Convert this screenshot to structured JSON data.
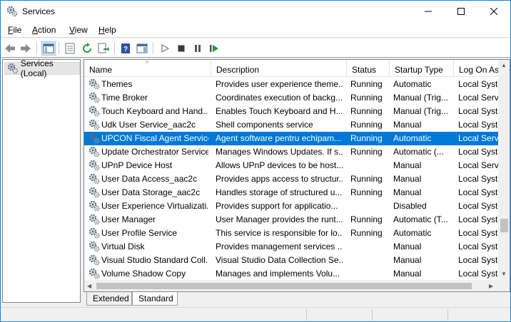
{
  "window": {
    "title": "Services"
  },
  "menu": {
    "file": {
      "accel": "F",
      "rest": "ile"
    },
    "action": {
      "accel": "A",
      "rest": "ction"
    },
    "view": {
      "accel": "V",
      "rest": "iew"
    },
    "help": {
      "accel": "H",
      "rest": "elp"
    }
  },
  "tree": {
    "label": "Services (Local)"
  },
  "columns": {
    "name": "Name",
    "description": "Description",
    "status": "Status",
    "startup": "Startup Type",
    "logon": "Log On As"
  },
  "rows": [
    {
      "name": "Themes",
      "description": "Provides user experience theme...",
      "status": "Running",
      "startup": "Automatic",
      "logon": "Local Syste"
    },
    {
      "name": "Time Broker",
      "description": "Coordinates execution of backg...",
      "status": "Running",
      "startup": "Manual (Trig...",
      "logon": "Local Servi"
    },
    {
      "name": "Touch Keyboard and Hand...",
      "description": "Enables Touch Keyboard and H...",
      "status": "Running",
      "startup": "Manual (Trig...",
      "logon": "Local Syste"
    },
    {
      "name": "Udk User Service_aac2c",
      "description": "Shell components service",
      "status": "Running",
      "startup": "Manual",
      "logon": "Local Syste"
    },
    {
      "name": "UPCON Fiscal Agent Service",
      "description": "Agent software pentru echipam...",
      "status": "Running",
      "startup": "Automatic",
      "logon": "Local Servi",
      "selected": true
    },
    {
      "name": "Update Orchestrator Service",
      "description": "Manages Windows Updates. If s...",
      "status": "Running",
      "startup": "Automatic (...",
      "logon": "Local Syste"
    },
    {
      "name": "UPnP Device Host",
      "description": "Allows UPnP devices to be host...",
      "status": "",
      "startup": "Manual",
      "logon": "Local Servi"
    },
    {
      "name": "User Data Access_aac2c",
      "description": "Provides apps access to structur...",
      "status": "Running",
      "startup": "Manual",
      "logon": "Local Syste"
    },
    {
      "name": "User Data Storage_aac2c",
      "description": "Handles storage of structured u...",
      "status": "Running",
      "startup": "Manual",
      "logon": "Local Syste"
    },
    {
      "name": "User Experience Virtualizati...",
      "description": "Provides support for applicatio...",
      "status": "",
      "startup": "Disabled",
      "logon": "Local Syste"
    },
    {
      "name": "User Manager",
      "description": "User Manager provides the runt...",
      "status": "Running",
      "startup": "Automatic (T...",
      "logon": "Local Syste"
    },
    {
      "name": "User Profile Service",
      "description": "This service is responsible for lo...",
      "status": "Running",
      "startup": "Automatic",
      "logon": "Local Syste"
    },
    {
      "name": "Virtual Disk",
      "description": "Provides management services ...",
      "status": "",
      "startup": "Manual",
      "logon": "Local Syste"
    },
    {
      "name": "Visual Studio Standard Coll...",
      "description": "Visual Studio Data Collection Se...",
      "status": "",
      "startup": "Manual",
      "logon": "Local Syste"
    },
    {
      "name": "Volume Shadow Copy",
      "description": "Manages and implements Volu...",
      "status": "",
      "startup": "Manual",
      "logon": "Local Syste"
    }
  ],
  "tabs": {
    "extended": "Extended",
    "standard": "Standard"
  },
  "colors": {
    "selection": "#0078d7",
    "accent_border": "#1883d7"
  }
}
